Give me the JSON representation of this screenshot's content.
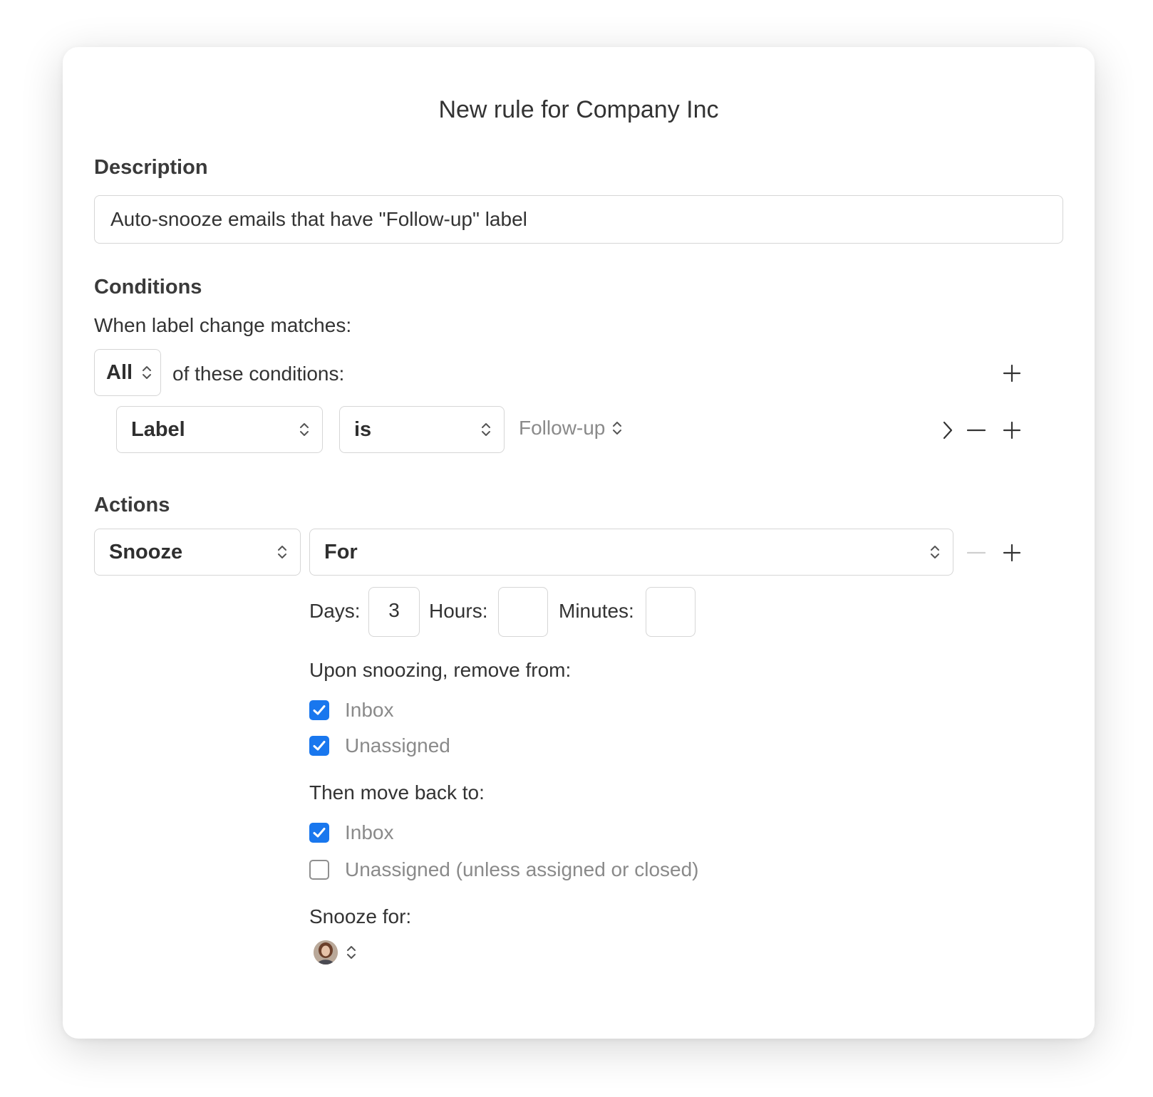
{
  "dialog": {
    "title": "New rule for Company Inc"
  },
  "description": {
    "heading": "Description",
    "value": "Auto-snooze emails that have \"Follow-up\" label"
  },
  "conditions": {
    "heading": "Conditions",
    "trigger_text": "When label change matches:",
    "match_mode": "All",
    "match_suffix": "of these conditions:",
    "rows": [
      {
        "field": "Label",
        "operator": "is",
        "value": "Follow-up"
      }
    ]
  },
  "actions": {
    "heading": "Actions",
    "action": "Snooze",
    "mode": "For",
    "duration": {
      "days_label": "Days:",
      "days_value": "3",
      "hours_label": "Hours:",
      "hours_value": "",
      "minutes_label": "Minutes:",
      "minutes_value": ""
    },
    "remove_from": {
      "label": "Upon snoozing, remove from:",
      "options": [
        {
          "label": "Inbox",
          "checked": true
        },
        {
          "label": "Unassigned",
          "checked": true
        }
      ]
    },
    "move_back": {
      "label": "Then move back to:",
      "options": [
        {
          "label": "Inbox",
          "checked": true
        },
        {
          "label": "Unassigned (unless assigned or closed)",
          "checked": false
        }
      ]
    },
    "snooze_for": {
      "label": "Snooze for:"
    }
  },
  "colors": {
    "accent": "#1977ee",
    "border": "#d6d6d6",
    "muted_text": "#8a8a8a"
  },
  "icons": [
    "chevron-updown-icon",
    "plus-icon",
    "minus-icon",
    "chevron-right-icon",
    "checkmark-icon",
    "user-avatar"
  ]
}
